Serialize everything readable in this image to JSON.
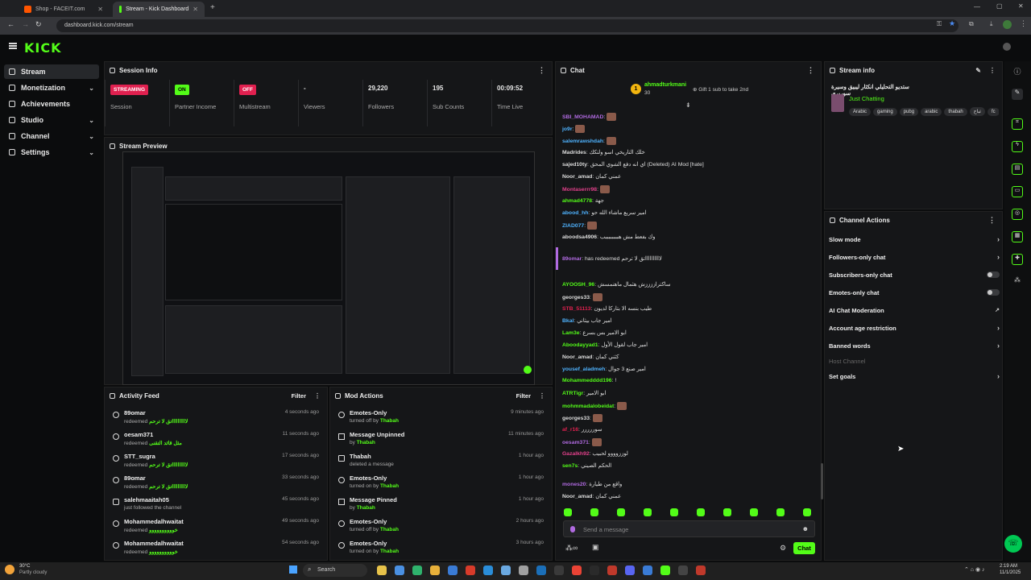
{
  "browser": {
    "tabs": [
      {
        "title": "Shop - FACEIT.com"
      },
      {
        "title": "Stream - Kick Dashboard"
      }
    ],
    "url": "dashboard.kick.com/stream"
  },
  "app": {
    "logo": "KICK"
  },
  "sidebar": {
    "items": [
      {
        "label": "Stream"
      },
      {
        "label": "Monetization"
      },
      {
        "label": "Achievements"
      },
      {
        "label": "Studio"
      },
      {
        "label": "Channel"
      },
      {
        "label": "Settings"
      }
    ]
  },
  "session": {
    "title": "Session Info",
    "stats": [
      {
        "value": "STREAMING",
        "label": "Session"
      },
      {
        "value": "ON",
        "label": "Partner Income"
      },
      {
        "value": "OFF",
        "label": "Multistream"
      },
      {
        "value": "-",
        "label": "Viewers"
      },
      {
        "value": "29,220",
        "label": "Followers"
      },
      {
        "value": "195",
        "label": "Sub Counts"
      },
      {
        "value": "00:09:52",
        "label": "Time Live"
      }
    ]
  },
  "preview": {
    "title": "Stream Preview"
  },
  "activity": {
    "title": "Activity Feed",
    "filter": "Filter",
    "items": [
      {
        "name": "89omar",
        "action": "redeemed",
        "detail": "لااااااااااتق لا ترحم",
        "time": "4 seconds ago"
      },
      {
        "name": "oesam371",
        "action": "redeemed",
        "detail": "مثل قائد التقنی",
        "time": "11 seconds ago"
      },
      {
        "name": "STT_sugra",
        "action": "redeemed",
        "detail": "لااااااااااتق لا ترحم",
        "time": "17 seconds ago"
      },
      {
        "name": "89omar",
        "action": "redeemed",
        "detail": "لااااااااااتق لا ترحم",
        "time": "33 seconds ago"
      },
      {
        "name": "salehmaaitah05",
        "action": "just followed the channel",
        "detail": "",
        "time": "45 seconds ago"
      },
      {
        "name": "Mohammedalhwaitat",
        "action": "redeemed",
        "detail": "خوووووووووو",
        "time": "49 seconds ago"
      },
      {
        "name": "Mohammedalhwaitat",
        "action": "redeemed",
        "detail": "خوووووووووو",
        "time": "54 seconds ago"
      }
    ]
  },
  "mod": {
    "title": "Mod Actions",
    "filter": "Filter",
    "items": [
      {
        "name": "Emotes-Only",
        "action": "turned off by",
        "by": "Thabah",
        "time": "9 minutes ago"
      },
      {
        "name": "Message Unpinned",
        "action": "by",
        "by": "Thabah",
        "time": "11 minutes ago"
      },
      {
        "name": "Thabah",
        "action": "deleted a message",
        "by": "",
        "time": "1 hour ago"
      },
      {
        "name": "Emotes-Only",
        "action": "turned on by",
        "by": "Thabah",
        "time": "1 hour ago"
      },
      {
        "name": "Message Pinned",
        "action": "by",
        "by": "Thabah",
        "time": "1 hour ago"
      },
      {
        "name": "Emotes-Only",
        "action": "turned off by",
        "by": "Thabah",
        "time": "2 hours ago"
      },
      {
        "name": "Emotes-Only",
        "action": "turned on by",
        "by": "Thabah",
        "time": "3 hours ago"
      }
    ]
  },
  "chat": {
    "title": "Chat",
    "pinned_user": "ahmadturkmani",
    "pinned_count": "30",
    "gift_text": "Gift 1 sub to take 2nd",
    "input_placeholder": "Send a message",
    "send_label": "Chat",
    "messages": [
      {
        "user": "SBI_MOHAMAD",
        "text": "",
        "color": "#b06ae0"
      },
      {
        "user": "jo9r",
        "text": "",
        "color": "#4fb3ff"
      },
      {
        "user": "salemrawshdah",
        "text": "",
        "color": "#4fb3ff"
      },
      {
        "user": "Madrides",
        "text": "خلك التاريخي اسو ولتكك",
        "color": "#ddd"
      },
      {
        "user": "sajed10ty",
        "text": "اي انه دفع الشوي المحق (Deleted) AI Mod [hate]",
        "color": "#ddd"
      },
      {
        "user": "Noor_amad",
        "text": "عمني كمان",
        "color": "#ddd"
      },
      {
        "user": "Montaserrr98",
        "text": "",
        "color": "#e0408a"
      },
      {
        "user": "ahmad4778",
        "text": "جهة",
        "color": "#53fc18"
      },
      {
        "user": "abood_hh",
        "text": "امير سريع ماشاء الله حو",
        "color": "#4fb3ff"
      },
      {
        "user": "ZIAD077",
        "text": "",
        "color": "#4fb3ff"
      },
      {
        "user": "aboodsa4906",
        "text": "وك بفعط مش هببببببببب",
        "color": "#ddd"
      },
      {
        "user": "89omar",
        "text": "has redeemed لااااااااااتق لا ترحم",
        "color": "#b06ae0"
      },
      {
        "user": "AYOOSH_96",
        "text": "ساكتراززززش هثمال ماهنمسش",
        "color": "#53fc18"
      },
      {
        "user": "georges33",
        "text": "",
        "color": "#ddd"
      },
      {
        "user": "STB_51113",
        "text": "طيب بنسه الا بتاركا لديون",
        "color": "#e0204f"
      },
      {
        "user": "Bkal",
        "text": "امير جاب بيثاني",
        "color": "#4fb3ff"
      },
      {
        "user": "Lam3e",
        "text": "ابو الامير بس بسرع",
        "color": "#53fc18"
      },
      {
        "user": "Aboodayyad1",
        "text": "امير جاب لقول الأول",
        "color": "#53fc18"
      },
      {
        "user": "Noor_amad",
        "text": "كثني كمان",
        "color": "#ddd"
      },
      {
        "user": "yousef_aladmeh",
        "text": "امير صنع 3 جوال",
        "color": "#4fb3ff"
      },
      {
        "user": "Mohammedddd196",
        "text": "!",
        "color": "#53fc18"
      },
      {
        "user": "ATRTigr",
        "text": "ابو الامير",
        "color": "#53fc18"
      },
      {
        "user": "mohmmadalobeidat",
        "text": "",
        "color": "#53fc18"
      },
      {
        "user": "georges33",
        "text": "",
        "color": "#ddd"
      },
      {
        "user": "af_r16",
        "text": "سوررررر",
        "color": "#e0204f"
      },
      {
        "user": "oesam371",
        "text": "",
        "color": "#b06ae0"
      },
      {
        "user": "Gazalkh92",
        "text": "لوززوووو لحبيب",
        "color": "#e0408a"
      },
      {
        "user": "sen7s",
        "text": "الحكم الصيني",
        "color": "#53fc18"
      },
      {
        "user": "mones20",
        "text": "واقع من طيارة",
        "color": "#b06ae0"
      },
      {
        "user": "Noor_amad",
        "text": "عمني كمان",
        "color": "#ddd"
      }
    ]
  },
  "stream_info": {
    "title": "Stream info",
    "stream_title": "ستديو التحليلي انكثار ليبيق وسيرة سوريري",
    "category": "Just Chatting",
    "tags": [
      "Arabic",
      "gaming",
      "pubg",
      "arabic",
      "thabah",
      "ثباح",
      "fc"
    ]
  },
  "channel_actions": {
    "title": "Channel Actions",
    "items": [
      {
        "label": "Slow mode",
        "kind": "arrow"
      },
      {
        "label": "Followers-only chat",
        "kind": "arrow"
      },
      {
        "label": "Subscribers-only chat",
        "kind": "toggle"
      },
      {
        "label": "Emotes-only chat",
        "kind": "toggle"
      },
      {
        "label": "AI Chat Moderation",
        "kind": "external"
      },
      {
        "label": "Account age restriction",
        "kind": "arrow"
      },
      {
        "label": "Banned words",
        "kind": "arrow"
      },
      {
        "label": "Host Channel",
        "kind": "disabled"
      },
      {
        "label": "Set goals",
        "kind": "arrow"
      }
    ]
  },
  "taskbar": {
    "weather_temp": "30°C",
    "weather_desc": "Partly cloudy",
    "search": "Search",
    "time": "2:19 AM",
    "date": "11/1/2025"
  },
  "colors": {
    "accent": "#53fc18",
    "danger": "#e0204f",
    "panel": "#151618"
  }
}
